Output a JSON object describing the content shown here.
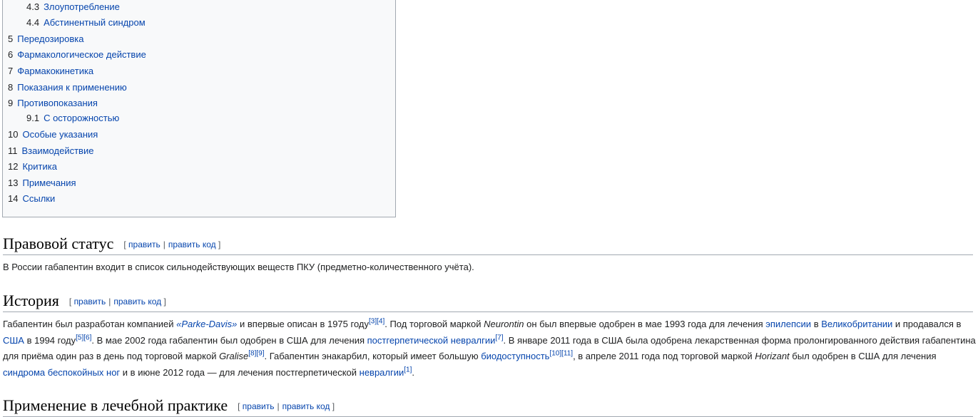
{
  "toc": {
    "items": [
      {
        "num": "4.3",
        "label": "Злоупотребление",
        "level": 2
      },
      {
        "num": "4.4",
        "label": "Абстинентный синдром",
        "level": 2
      },
      {
        "num": "5",
        "label": "Передозировка",
        "level": 1
      },
      {
        "num": "6",
        "label": "Фармакологическое действие",
        "level": 1
      },
      {
        "num": "7",
        "label": "Фармакокинетика",
        "level": 1
      },
      {
        "num": "8",
        "label": "Показания к применению",
        "level": 1
      },
      {
        "num": "9",
        "label": "Противопоказания",
        "level": 1
      },
      {
        "num": "9.1",
        "label": "С осторожностью",
        "level": 2
      },
      {
        "num": "10",
        "label": "Особые указания",
        "level": 1
      },
      {
        "num": "11",
        "label": "Взаимодействие",
        "level": 1
      },
      {
        "num": "12",
        "label": "Критика",
        "level": 1
      },
      {
        "num": "13",
        "label": "Примечания",
        "level": 1
      },
      {
        "num": "14",
        "label": "Ссылки",
        "level": 1
      }
    ]
  },
  "edit": {
    "open": "[",
    "close": "]",
    "sep": "|",
    "edit": "править",
    "edit_code": "править код"
  },
  "sections": {
    "legal": {
      "title": "Правовой статус",
      "text": "В России габапентин входит в список сильнодействующих веществ ПКУ (предметно-количественного учёта)."
    },
    "history": {
      "title": "История",
      "p": {
        "t1": "Габапентин был разработан компанией ",
        "l_parke": "«Parke-Davis»",
        "t2": " и впервые описан в 1975 году",
        "r3": "[3]",
        "r4": "[4]",
        "t3": ". Под торговой маркой ",
        "neurontin": "Neurontin",
        "t4": " он был впервые одобрен в мае 1993 года для лечения ",
        "l_epilepsy": "эпилепсии",
        "t5": " в ",
        "l_uk": "Великобритании",
        "t6": " и продавался в ",
        "l_usa": "США",
        "t7": " в 1994 году",
        "r5": "[5]",
        "r6": "[6]",
        "t8": ". В мае 2002 года габапентин был одобрен в США для лечения ",
        "l_pgn": "постгерпетической невралгии",
        "r7": "[7]",
        "t9": ". В январе 2011 года в США была одобрена лекарственная форма пролонгированного действия габапентина для приёма один раз в день под торговой маркой ",
        "gralise": "Gralise",
        "r8": "[8]",
        "r9": "[9]",
        "t10": ". Габапентин энакарбил, который имеет большую ",
        "l_bio": "биодоступность",
        "r10": "[10]",
        "r11": "[11]",
        "t11": ", в апреле 2011 года под торговой маркой ",
        "horizant": "Horizant",
        "t12": " был одобрен в США для лечения ",
        "l_rls": "синдрома беспокойных ног",
        "t13": " и в июне 2012 года — для лечения постгерпетической ",
        "l_neur": "невралгии",
        "r1": "[1]",
        "t14": "."
      }
    },
    "practice": {
      "title": "Применение в лечебной практике"
    }
  }
}
